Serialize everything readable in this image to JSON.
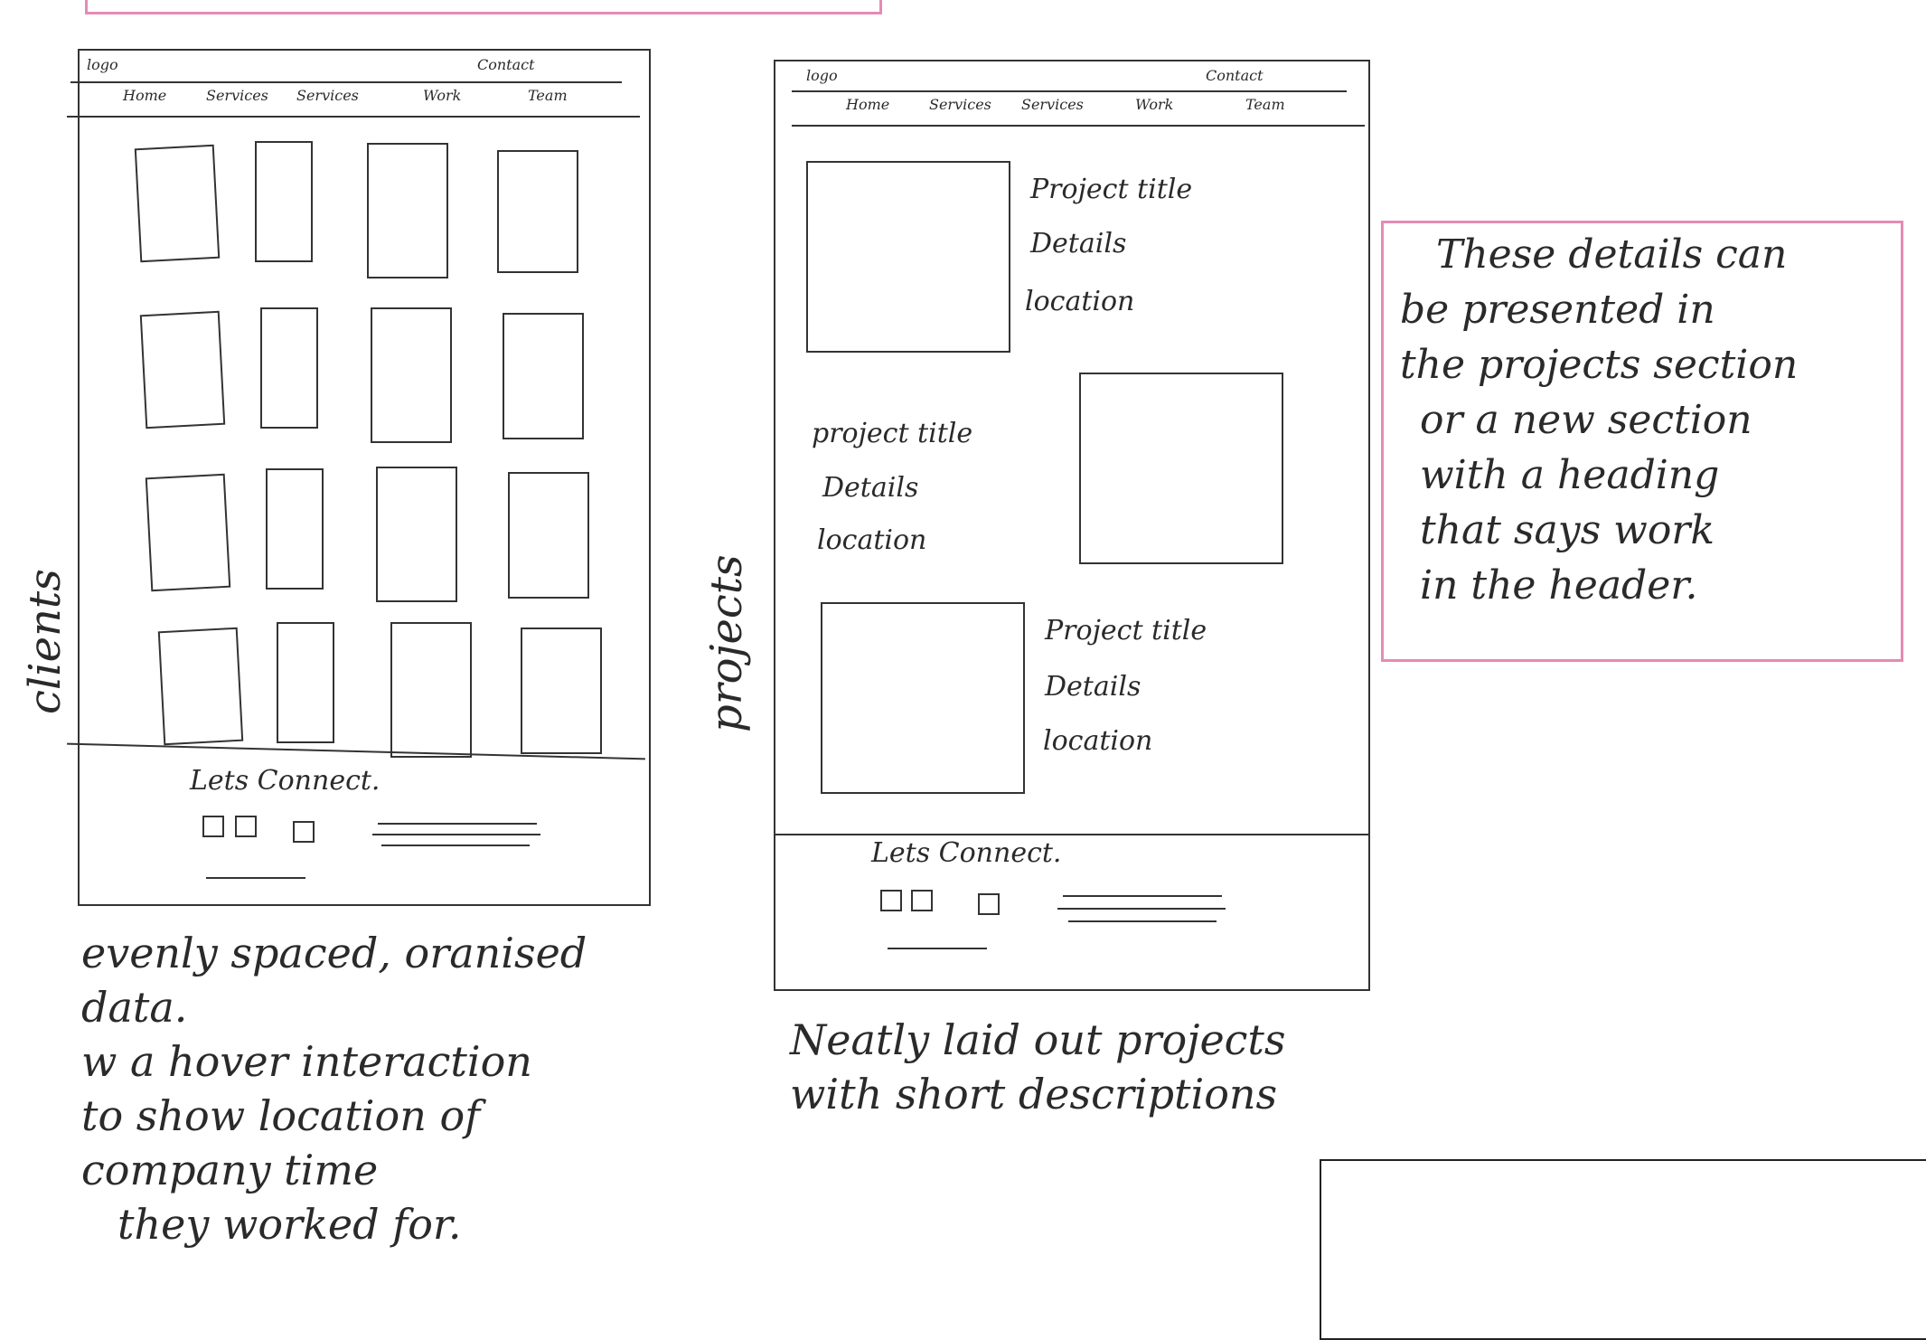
{
  "wireframe_clients": {
    "header": {
      "logo": "logo",
      "contact": "Contact",
      "nav": [
        "Home",
        "Services",
        "Services",
        "Work",
        "Team"
      ]
    },
    "footer_title": "Lets Connect.",
    "side_label": "clients"
  },
  "wireframe_projects": {
    "header": {
      "logo": "logo",
      "contact": "Contact",
      "nav": [
        "Home",
        "Services",
        "Services",
        "Work",
        "Team"
      ]
    },
    "projects": [
      {
        "title": "Project title",
        "details": "Details",
        "location": "location"
      },
      {
        "title": "project title",
        "details": "Details",
        "location": "location"
      },
      {
        "title": "Project title",
        "details": "Details",
        "location": "location"
      }
    ],
    "footer_title": "Lets Connect.",
    "side_label": "projects"
  },
  "captions": {
    "left": [
      "evenly spaced, oranised",
      "data.",
      "w a hover interaction",
      "to show location of",
      "company time",
      "they worked for."
    ],
    "middle": [
      "Neatly laid out projects",
      "with short descriptions"
    ]
  },
  "note": {
    "lines": [
      "These details can",
      "be presented in",
      "the projects section",
      "or a new section",
      "with a heading",
      "that says work",
      "in the header."
    ]
  },
  "colors": {
    "ink": "#2a2a2a",
    "note_border": "#e58bb5"
  }
}
